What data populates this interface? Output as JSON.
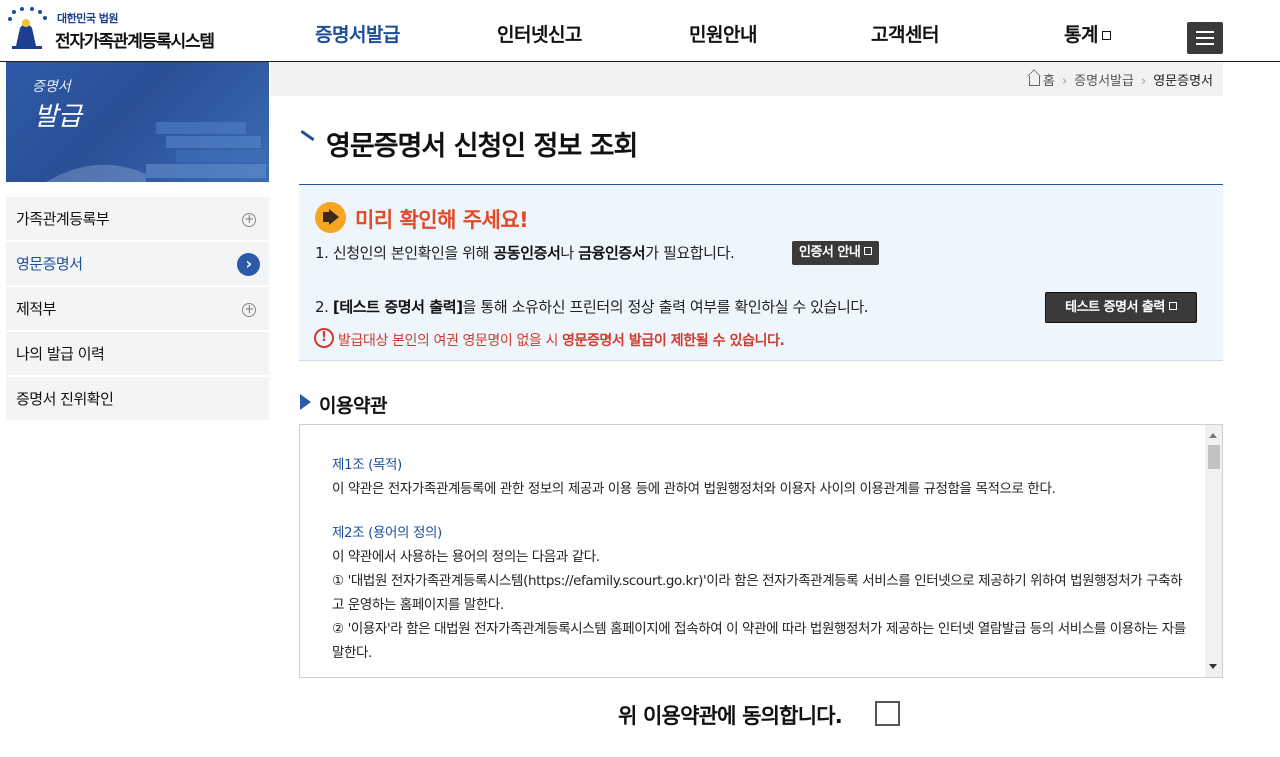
{
  "header": {
    "logo_sub": "대한민국 법원",
    "logo_main": "전자가족관계등록시스템",
    "nav": [
      {
        "label": "증명서발급",
        "active": true
      },
      {
        "label": "인터넷신고"
      },
      {
        "label": "민원안내"
      },
      {
        "label": "고객센터"
      },
      {
        "label": "통계",
        "external": true
      }
    ],
    "menu_icon": "hamburger-icon"
  },
  "side": {
    "visual_line1": "증명서",
    "visual_line2": "발급",
    "items": [
      {
        "label": "가족관계등록부",
        "icon": "plus-circle-icon"
      },
      {
        "label": "영문증명서",
        "icon": "chevron-right-circle-icon",
        "active": true
      },
      {
        "label": "제적부",
        "icon": "plus-circle-icon"
      },
      {
        "label": "나의 발급 이력"
      },
      {
        "label": "증명서 진위확인"
      }
    ]
  },
  "breadcrumb": {
    "home": "홈",
    "level1": "증명서발급",
    "current": "영문증명서"
  },
  "page_title": "영문증명서 신청인 정보 조회",
  "notice": {
    "title": "미리 확인해 주세요!",
    "line1_pre": "1. 신청인의 본인확인을 위해 ",
    "line1_b1": "공동인증서",
    "line1_mid": "나 ",
    "line1_b2": "금융인증서",
    "line1_post": "가 필요합니다.",
    "cert_button": "인증서 안내",
    "line2_pre": "2. ",
    "line2_b": "[테스트 증명서 출력]",
    "line2_post": "을 통해 소유하신 프린터의 정상 출력 여부를 확인하실 수 있습니다.",
    "test_button": "테스트 증명서 출력",
    "warning_pre": "발급대상 본인의 여권 영문명이 없을 시 ",
    "warning_b": "영문증명서 발급이 제한될 수 있습니다.",
    "accent_color": "#e04b2a",
    "warning_color": "#d23a2e"
  },
  "terms": {
    "section_title": "이용약관",
    "art1_title": "제1조 (목적)",
    "art1_body": "이 약관은 전자가족관계등록에 관한 정보의 제공과 이용 등에 관하여 법원행정처와 이용자 사이의 이용관계를 규정함을 목적으로 한다.",
    "art2_title": "제2조 (용어의 정의)",
    "art2_intro": "이 약관에서 사용하는 용어의 정의는 다음과 같다.",
    "art2_item1": "① '대법원 전자가족관계등록시스템(https://efamily.scourt.go.kr)'이라 함은 전자가족관계등록 서비스를 인터넷으로 제공하기 위하여 법원행정처가 구축하고 운영하는 홈페이지를 말한다.",
    "art2_item2": "② '이용자'라 함은 대법원 전자가족관계등록시스템 홈페이지에 접속하여 이 약관에 따라 법원행정처가 제공하는 인터넷 열람발급 등의 서비스를 이용하는 자를 말한다."
  },
  "agree": {
    "label": "위 이용약관에 동의합니다."
  },
  "colors": {
    "brand": "#1d4f9c",
    "dark_button": "#3a3a3a"
  }
}
